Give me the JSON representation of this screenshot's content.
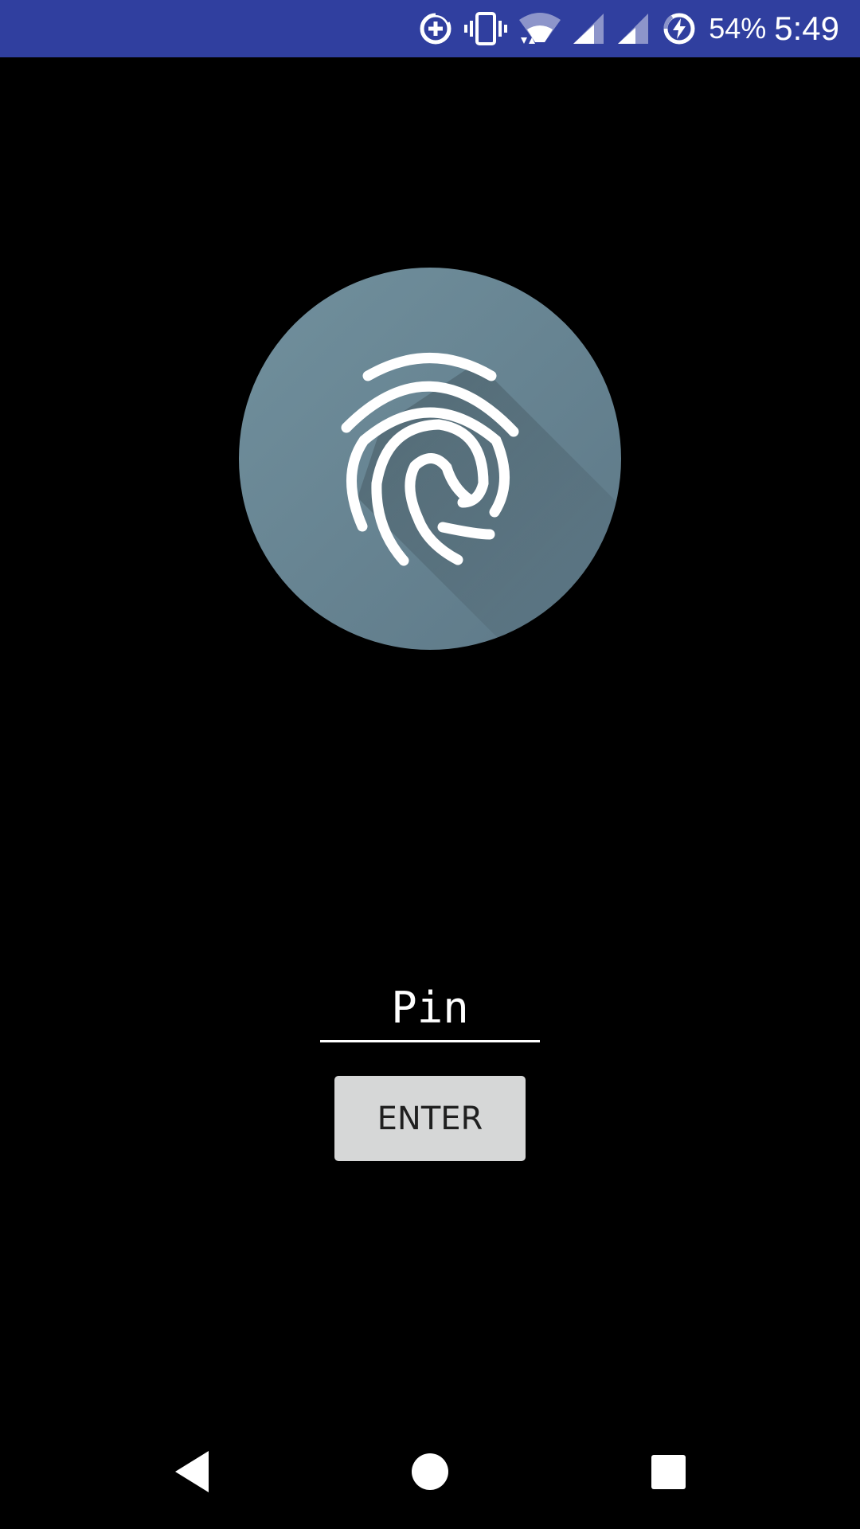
{
  "status_bar": {
    "background": "#303F9F",
    "icons": [
      "data-saver-icon",
      "vibrate-icon",
      "wifi-icon",
      "signal-icon",
      "signal-icon-2",
      "battery-charging-icon"
    ],
    "battery_percent": "54%",
    "time": "5:49"
  },
  "fingerprint": {
    "icon": "fingerprint-icon",
    "circle_color": "#607D8B"
  },
  "pin_input": {
    "placeholder": "Pin",
    "value": ""
  },
  "enter_button": {
    "label": "ENTER",
    "background": "#D6D7D7"
  },
  "nav_bar": {
    "back": "back-icon",
    "home": "home-icon",
    "recents": "recents-icon"
  }
}
